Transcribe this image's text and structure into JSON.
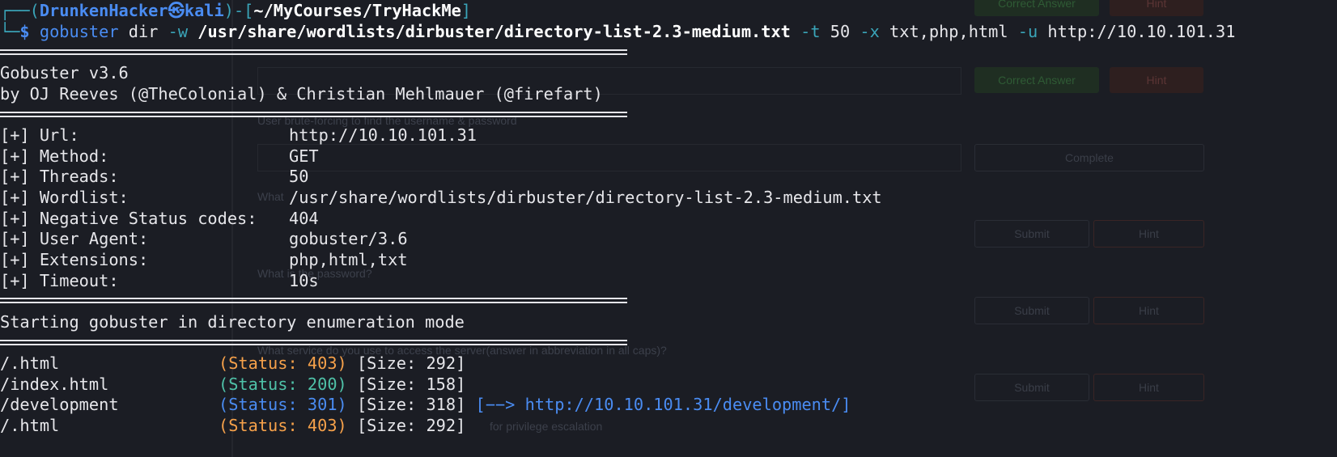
{
  "background_page": {
    "buttons": [
      {
        "label": "Correct Answer",
        "kind": "correct"
      },
      {
        "label": "Hint",
        "kind": "hint"
      },
      {
        "label": "Correct Answer",
        "kind": "correct"
      },
      {
        "label": "Hint",
        "kind": "hint"
      },
      {
        "label": "Complete",
        "kind": "complete"
      },
      {
        "label": "Submit",
        "kind": "submit"
      },
      {
        "label": "Hint",
        "kind": "hint"
      },
      {
        "label": "Submit",
        "kind": "submit"
      },
      {
        "label": "Hint",
        "kind": "hint"
      },
      {
        "label": "Submit",
        "kind": "submit"
      },
      {
        "label": "Hint",
        "kind": "hint"
      }
    ],
    "questions": [
      "User brute-forcing to find the username & password",
      "What",
      "What is the password?",
      "What service do you use to access the server(answer in abbreviation in all caps)?",
      "for privilege escalation"
    ]
  },
  "prompt": {
    "frame_open": "┌──(",
    "user": "DrunkenHacker",
    "at_icon": "㉿",
    "host": "kali",
    "frame_mid": ")-[",
    "cwd": "~/MyCourses/TryHackMe",
    "frame_close": "]",
    "frame_second": "└─",
    "symbol": "$"
  },
  "command": {
    "program": "gobuster",
    "subcommand": "dir",
    "flag_w": "-w",
    "wordlist": "/usr/share/wordlists/dirbuster/directory-list-2.3-medium.txt",
    "flag_t": "-t",
    "threads": "50",
    "flag_x": "-x",
    "extensions": "txt,php,html",
    "flag_u": "-u",
    "url": "http://10.10.101.31"
  },
  "banner": {
    "version": "Gobuster v3.6",
    "authors": "by OJ Reeves (@TheColonial) & Christian Mehlmauer (@firefart)"
  },
  "config": [
    {
      "key": "[+] Url:",
      "value": "http://10.10.101.31"
    },
    {
      "key": "[+] Method:",
      "value": "GET"
    },
    {
      "key": "[+] Threads:",
      "value": "50"
    },
    {
      "key": "[+] Wordlist:",
      "value": "/usr/share/wordlists/dirbuster/directory-list-2.3-medium.txt"
    },
    {
      "key": "[+] Negative Status codes:",
      "value": "404"
    },
    {
      "key": "[+] User Agent:",
      "value": "gobuster/3.6"
    },
    {
      "key": "[+] Extensions:",
      "value": "php,html,txt"
    },
    {
      "key": "[+] Timeout:",
      "value": "10s"
    }
  ],
  "mode_line": "Starting gobuster in directory enumeration mode",
  "results": [
    {
      "path": "/.html",
      "status": "(Status: 403)",
      "code": "403",
      "size": "[Size: 292]",
      "redirect": ""
    },
    {
      "path": "/index.html",
      "status": "(Status: 200)",
      "code": "200",
      "size": "[Size: 158]",
      "redirect": ""
    },
    {
      "path": "/development",
      "status": "(Status: 301)",
      "code": "301",
      "size": "[Size: 318]",
      "redirect": "[−−> http://10.10.101.31/development/]"
    },
    {
      "path": "/.html",
      "status": "(Status: 403)",
      "code": "403",
      "size": "[Size: 292]",
      "redirect": ""
    }
  ],
  "colors": {
    "background": "#1b1d24",
    "text": "#e6e6ea",
    "prompt_frame": "#3aa4b8",
    "user": "#4a8cf2",
    "status_403": "#f6a14a",
    "status_200": "#4fc2a8",
    "status_301": "#4a8cf2"
  }
}
